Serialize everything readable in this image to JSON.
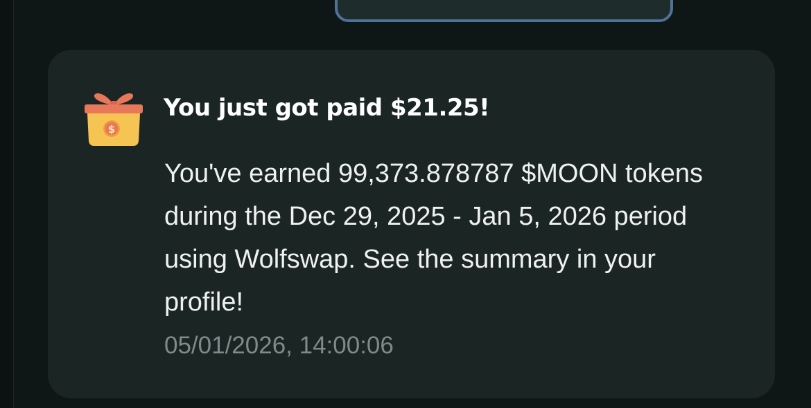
{
  "notification": {
    "icon": "gift-box-icon",
    "title": "You just got paid $21.25!",
    "body": "You've earned 99,373.878787 $MOON tokens during the Dec 29, 2025 - Jan 5, 2026 period using Wolfswap. See the summary in your profile!",
    "timestamp": "05/01/2026, 14:00:06"
  },
  "colors": {
    "background": "#0f1716",
    "card_background": "#1b2624",
    "previous_card_border": "#4f7298",
    "title_text": "#ffffff",
    "body_text": "#eef1f0",
    "timestamp_text": "#7e8b8a",
    "gift_box": "#f6c453",
    "gift_ribbon": "#e8785a"
  }
}
